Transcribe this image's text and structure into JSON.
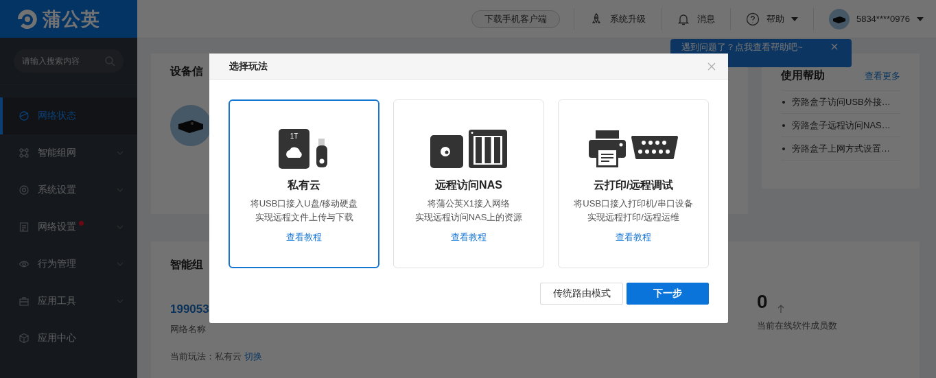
{
  "brand": {
    "name": "蒲公英"
  },
  "search": {
    "placeholder": "请输入搜索内容"
  },
  "sidebar": {
    "items": [
      {
        "kind": "status",
        "label": "网络状态",
        "selected": true,
        "expandable": false,
        "dot": false
      },
      {
        "kind": "mesh",
        "label": "智能组网",
        "selected": false,
        "expandable": true,
        "dot": false
      },
      {
        "kind": "system",
        "label": "系统设置",
        "selected": false,
        "expandable": true,
        "dot": false
      },
      {
        "kind": "network",
        "label": "网络设置",
        "selected": false,
        "expandable": true,
        "dot": true
      },
      {
        "kind": "behavior",
        "label": "行为管理",
        "selected": false,
        "expandable": true,
        "dot": false
      },
      {
        "kind": "tools",
        "label": "应用工具",
        "selected": false,
        "expandable": true,
        "dot": false
      },
      {
        "kind": "apps",
        "label": "应用中心",
        "selected": false,
        "expandable": false,
        "dot": false
      }
    ]
  },
  "topbar": {
    "download_button": "下载手机客户端",
    "items": [
      {
        "kind": "upgrade",
        "label": "系统升级",
        "caret": false
      },
      {
        "kind": "messages",
        "label": "消息",
        "caret": false
      },
      {
        "kind": "help",
        "label": "帮助",
        "caret": true
      }
    ],
    "user": {
      "name": "5834****0976"
    }
  },
  "tooltip": {
    "text": "遇到问题了？点我查看帮助吧~"
  },
  "device_card": {
    "title": "设备信"
  },
  "help_card": {
    "title": "使用帮助",
    "more": "查看更多",
    "items": [
      "旁路盒子访问USB外接…",
      "旁路盒子远程访问NAS…",
      "旁路盒子上网方式设置…"
    ]
  },
  "network_card": {
    "title": "智能组",
    "network_id": "199053",
    "name_label": "网络名称",
    "mode_label": "当前玩法：私有云",
    "switch_link": "切换",
    "online_count": "0",
    "online_label": "当前在线软件成员数"
  },
  "modal": {
    "title": "选择玩法",
    "options": [
      {
        "kind": "cloud",
        "icon_label": "1T",
        "title": "私有云",
        "lines": [
          "将USB口接入U盘/移动硬盘",
          "实现远程文件上传与下载"
        ],
        "link": "查看教程",
        "selected": true
      },
      {
        "kind": "nas",
        "title": "远程访问NAS",
        "lines": [
          "将蒲公英X1接入网络",
          "实现远程访问NAS上的资源"
        ],
        "link": "查看教程",
        "selected": false
      },
      {
        "kind": "print",
        "title": "云打印/远程调试",
        "lines": [
          "将USB口接入打印机/串口设备",
          "实现远程打印/远程运维"
        ],
        "link": "查看教程",
        "selected": false
      }
    ],
    "buttons": [
      {
        "label": "传统路由模式",
        "primary": false
      },
      {
        "label": "下一步",
        "primary": true
      }
    ]
  }
}
